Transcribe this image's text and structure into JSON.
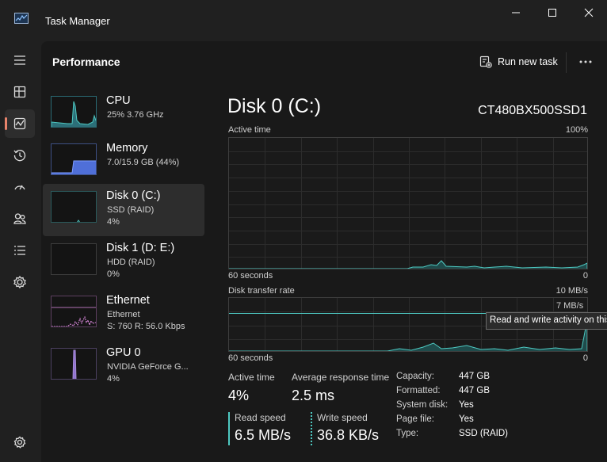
{
  "window": {
    "title": "Task Manager"
  },
  "header": {
    "title": "Performance",
    "run_task_label": "Run new task"
  },
  "nav_icons": [
    "menu-icon",
    "processes-icon",
    "performance-icon",
    "app-history-icon",
    "startup-apps-icon",
    "users-icon",
    "details-icon",
    "services-icon",
    "settings-icon"
  ],
  "devices": [
    {
      "name": "CPU",
      "sub": "25%  3.76 GHz",
      "val": ""
    },
    {
      "name": "Memory",
      "sub": "7.0/15.9 GB (44%)",
      "val": ""
    },
    {
      "name": "Disk 0 (C:)",
      "sub": "SSD (RAID)",
      "val": "4%"
    },
    {
      "name": "Disk 1 (D: E:)",
      "sub": "HDD (RAID)",
      "val": "0%"
    },
    {
      "name": "Ethernet",
      "sub": "Ethernet",
      "val": "S: 760  R: 56.0 Kbps"
    },
    {
      "name": "GPU 0",
      "sub": "NVIDIA GeForce G...",
      "val": "4%"
    }
  ],
  "detail": {
    "title": "Disk 0 (C:)",
    "model": "CT480BX500SSD1",
    "graph1": {
      "label": "Active time",
      "max": "100%",
      "time_label": "60 seconds",
      "min": "0"
    },
    "graph2": {
      "label": "Disk transfer rate",
      "max": "10 MB/s",
      "secondary": "7 MB/s",
      "time_label": "60 seconds",
      "min": "0"
    },
    "tooltip": "Read and write activity on this disk",
    "stats": {
      "active_time_label": "Active time",
      "active_time": "4%",
      "avg_resp_label": "Average response time",
      "avg_resp": "2.5 ms",
      "read_label": "Read speed",
      "read": "6.5 MB/s",
      "write_label": "Write speed",
      "write": "36.8 KB/s"
    },
    "props": [
      {
        "k": "Capacity:",
        "v": "447 GB"
      },
      {
        "k": "Formatted:",
        "v": "447 GB"
      },
      {
        "k": "System disk:",
        "v": "Yes"
      },
      {
        "k": "Page file:",
        "v": "Yes"
      },
      {
        "k": "Type:",
        "v": "SSD (RAID)"
      }
    ]
  },
  "colors": {
    "accent": "#e8836b",
    "disk": "#4ec9c2",
    "memory": "#4f7df0",
    "ethernet": "#e58fe8",
    "gpu": "#a98ed8"
  }
}
